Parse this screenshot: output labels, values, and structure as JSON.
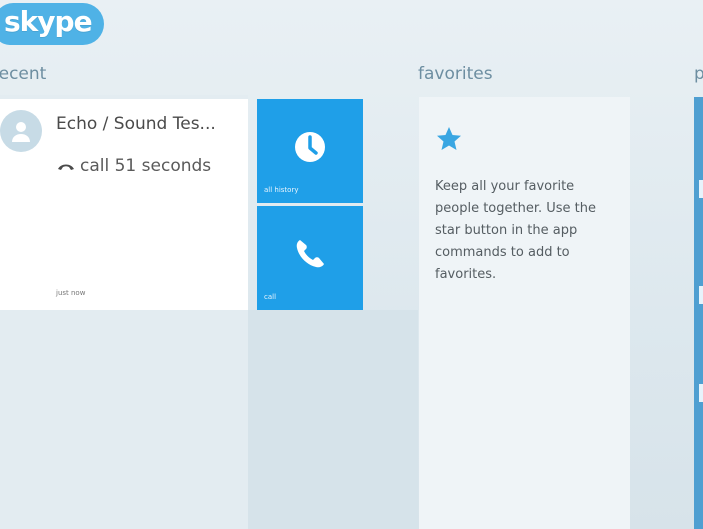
{
  "app": {
    "logo_text": "skype",
    "brand_color": "#4fb2e6",
    "accent": "#1f9fe8"
  },
  "sections": {
    "recent": "recent",
    "favorites": "favorites",
    "people": "p"
  },
  "recent": {
    "contact_name": "Echo / Sound Tes...",
    "call_summary": "call 51 seconds",
    "time_ago": "just now",
    "avatar_icon": "person-icon",
    "call_icon": "phone-hangup-icon"
  },
  "actions": {
    "history": {
      "label": "all history",
      "icon": "clock-icon"
    },
    "call": {
      "label": "call",
      "icon": "phone-icon"
    }
  },
  "favorites": {
    "icon": "star-icon",
    "empty_text": "Keep all your favorite people together. Use the star button in the app commands to add to favorites."
  }
}
